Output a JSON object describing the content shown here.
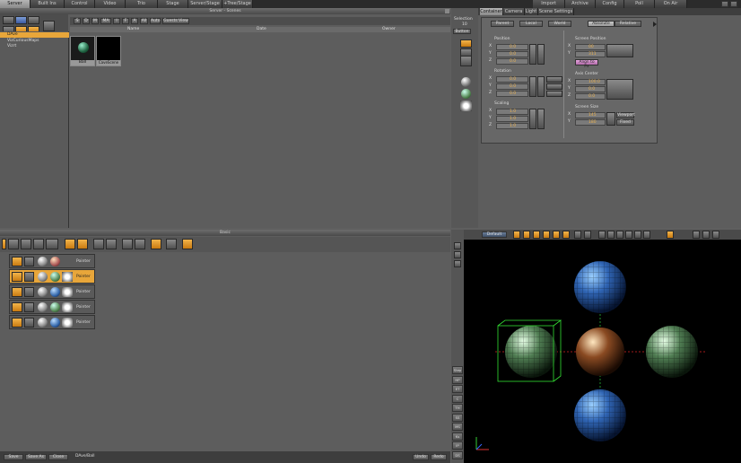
{
  "top_tabs": [
    "Server",
    "Built Ins",
    "Control",
    "Video",
    "Trio",
    "Stage",
    "Server/Stage",
    "+Tree/Stage"
  ],
  "top_right_tabs": [
    "Import",
    "Archive",
    "Config",
    "Poll",
    "On Air"
  ],
  "server": {
    "title": "Server - Scenes",
    "filters": [
      "S",
      "D",
      "M",
      "MA",
      "I",
      "F",
      "A",
      "All",
      "Auto",
      "Guests View"
    ],
    "tree": [
      "DAve",
      "VizCuriousMaps",
      "Vizrt"
    ],
    "columns": [
      "Name",
      "Date",
      "Owner"
    ],
    "thumbs": [
      "Ball",
      "CaveScene"
    ]
  },
  "properties": {
    "selection_label": "Selection",
    "selection_value": "10",
    "button_label": "Button",
    "tabs": [
      "Container",
      "Camera",
      "Light",
      "Scene Settings"
    ],
    "modes": [
      "Parent",
      "Local",
      "World"
    ],
    "abs_rel": [
      "Absolute",
      "Relative"
    ],
    "position_title": "Position",
    "rotation_title": "Rotation",
    "scaling_title": "Scaling",
    "screen_pos_title": "Screen Position",
    "axis_center_title": "Axis Center",
    "screen_size_title": "Screen Size",
    "position": {
      "x": "0.0",
      "y": "0.0",
      "z": "0.0"
    },
    "rotation": {
      "x": "0.0",
      "y": "0.0",
      "z": "0.0"
    },
    "scaling": {
      "x": "1.0",
      "y": "1.0",
      "z": "1.0"
    },
    "screen_position": {
      "x": "00",
      "y": "311"
    },
    "align_label": "Align to Px",
    "axis_center": {
      "x": "100.0",
      "y": "0.0",
      "z": "0.0"
    },
    "screen_size": {
      "x": "145",
      "y": "180"
    },
    "size_btns": [
      "Viewport",
      "Fixed"
    ]
  },
  "tree": {
    "title": "Basic",
    "rows": [
      "Pointer",
      "Pointer",
      "Pointer",
      "Pointer",
      "Pointer"
    ],
    "bottom_buttons": [
      "Save",
      "Save As",
      "Close"
    ],
    "path": "DAve/Ball",
    "right_buttons": [
      "Undo",
      "Redo"
    ]
  },
  "viewport": {
    "camera_label": "Default",
    "side_buttons": [
      "Step",
      "HP",
      "ET",
      "C",
      "TH",
      "SS",
      "MS",
      "Ks",
      "IP",
      "DS"
    ]
  }
}
